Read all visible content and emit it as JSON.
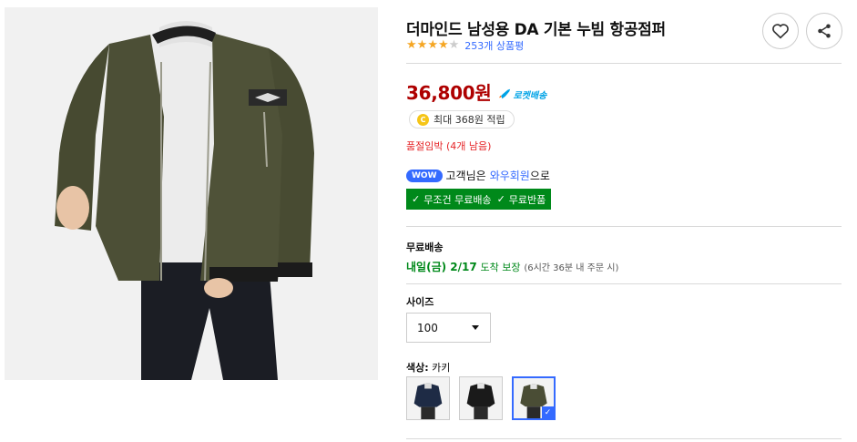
{
  "product": {
    "title": "더마인드 남성용 DA 기본 누빔 항공점퍼",
    "rating": {
      "stars": 4,
      "max_stars": 5,
      "review_count": "253개 상품평"
    },
    "price": "36,800원",
    "rocket_label": "로켓배송",
    "points": {
      "coin_symbol": "C",
      "text": "최대 368원 적립"
    },
    "stock_warning": "품절임박 (4개 남음)",
    "wow": {
      "badge": "WOW",
      "prefix": "고객님은",
      "link": "와우회원",
      "suffix": "으로"
    },
    "benefits": {
      "free_shipping": "무조건 무료배송",
      "free_return": "무료반품"
    },
    "shipping": {
      "label": "무료배송",
      "date": "내일(금) 2/17",
      "guarantee": "도착 보장",
      "note": "(6시간 36분 내 주문 시)"
    },
    "size": {
      "label": "사이즈",
      "selected": "100"
    },
    "color": {
      "label": "색상:",
      "selected": "카키",
      "options": [
        {
          "name": "navy",
          "hex": "#1e2b45"
        },
        {
          "name": "black",
          "hex": "#1a1a1a"
        },
        {
          "name": "khaki",
          "hex": "#4a4d35"
        }
      ],
      "selected_index": 2
    }
  },
  "colors": {
    "price": "#ae0000",
    "link": "#346aff",
    "green": "#00891a",
    "warning": "#e52528",
    "star": "#f5a623"
  },
  "icons": [
    "heart-icon",
    "share-icon",
    "rocket-icon",
    "coin-icon",
    "check-icon",
    "chevron-down-icon"
  ]
}
